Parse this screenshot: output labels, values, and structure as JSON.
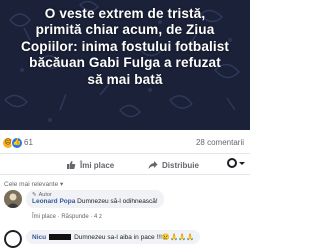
{
  "post": {
    "headline_lines": [
      "O veste extrem de tristă,",
      "primită chiar acum, de Ziua",
      "Copiilor: inima fostului fotbalist",
      "băcăuan Gabi Fulga a refuzat",
      "să mai bată"
    ],
    "banner_color": "#1a2138"
  },
  "reactions": {
    "icons": [
      "sad-reaction-icon",
      "like-reaction-icon"
    ],
    "count": "61",
    "comments": "28 comentarii"
  },
  "actions": {
    "like_label": "Îmi place",
    "share_label": "Distribuie"
  },
  "comments_section": {
    "sort_label": "Cele mai relevante ▾",
    "items": [
      {
        "badge": "Autor",
        "author": "Leonard Popa",
        "text": "Dumnezeu să-l odihnească!",
        "reply_action": "Îmi place · Răspunde · 4 z"
      },
      {
        "author": "Nicu",
        "text": "Dumnezeu sa-l aiba in pace !!!😢🙏🙏🙏"
      }
    ]
  },
  "colors": {
    "accent": "#1877f2",
    "link_name": "#385898",
    "muted": "#65676b"
  }
}
